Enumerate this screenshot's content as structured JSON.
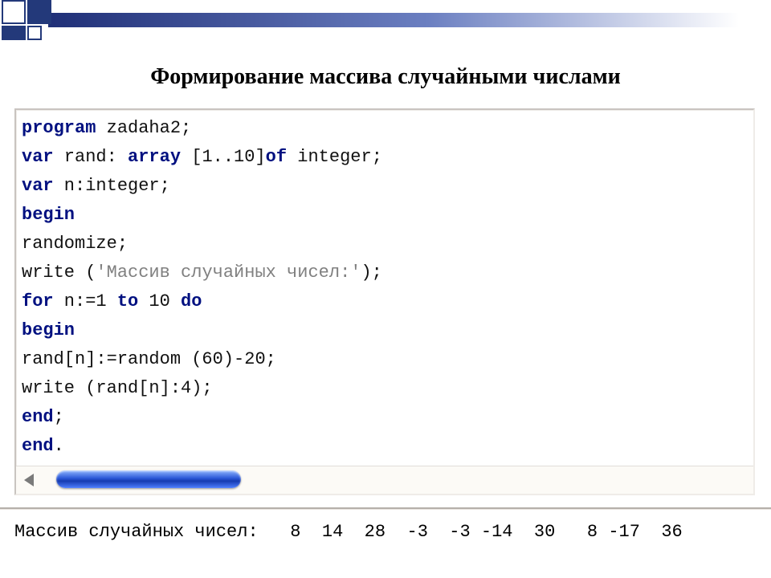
{
  "title": "Формирование массива случайными числами",
  "code": {
    "l1": {
      "kw1": "program",
      "rest": " zadaha2;"
    },
    "l2": {
      "kw1": "var",
      "mid": " rand: ",
      "kw2": "array",
      "brk": " [1..10]",
      "kw3": "of",
      "rest": " integer;"
    },
    "l3": {
      "kw1": "var",
      "rest": " n:integer;"
    },
    "l4": {
      "kw1": "begin"
    },
    "l5": {
      "txt": "randomize;"
    },
    "l6": {
      "a": "write (",
      "str": "'Массив случайных чисел:'",
      "b": ");"
    },
    "l7": {
      "kw1": "for",
      "a": " n:=1 ",
      "kw2": "to",
      "b": " 10 ",
      "kw3": "do"
    },
    "l8": {
      "kw1": "begin"
    },
    "l9": {
      "txt": "rand[n]:=random (60)-20;"
    },
    "l10": {
      "txt": "write (rand[n]:4);"
    },
    "l11": {
      "kw1": "end",
      "semi": ";"
    },
    "l12": {
      "kw1": "end",
      "dot": "."
    }
  },
  "output_label": "Массив случайных чисел:",
  "output_values": "   8  14  28  -3  -3 -14  30   8 -17  36"
}
